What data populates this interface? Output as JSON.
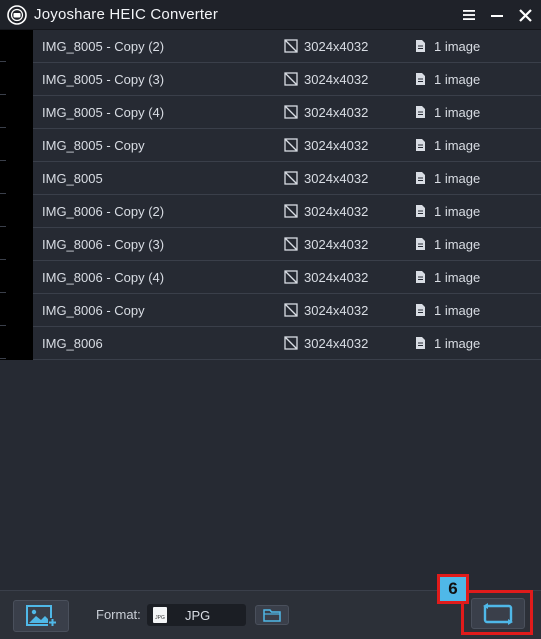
{
  "app": {
    "title": "Joyoshare HEIC Converter",
    "accent_color": "#4fb8e8",
    "highlight_color": "#e01b1b"
  },
  "window_controls": [
    {
      "name": "menu-icon"
    },
    {
      "name": "minimize-icon"
    },
    {
      "name": "close-icon"
    }
  ],
  "files": [
    {
      "name": "IMG_8005 - Copy (2)",
      "resolution": "3024x4032",
      "count": "1 image"
    },
    {
      "name": "IMG_8005 - Copy (3)",
      "resolution": "3024x4032",
      "count": "1 image"
    },
    {
      "name": "IMG_8005 - Copy (4)",
      "resolution": "3024x4032",
      "count": "1 image"
    },
    {
      "name": "IMG_8005 - Copy",
      "resolution": "3024x4032",
      "count": "1 image"
    },
    {
      "name": "IMG_8005",
      "resolution": "3024x4032",
      "count": "1 image"
    },
    {
      "name": "IMG_8006 - Copy (2)",
      "resolution": "3024x4032",
      "count": "1 image"
    },
    {
      "name": "IMG_8006 - Copy (3)",
      "resolution": "3024x4032",
      "count": "1 image"
    },
    {
      "name": "IMG_8006 - Copy (4)",
      "resolution": "3024x4032",
      "count": "1 image"
    },
    {
      "name": "IMG_8006 - Copy",
      "resolution": "3024x4032",
      "count": "1 image"
    },
    {
      "name": "IMG_8006",
      "resolution": "3024x4032",
      "count": "1 image"
    }
  ],
  "bottom": {
    "format_label": "Format:",
    "format_value": "JPG",
    "format_chip": "JPG",
    "step_badge": "6"
  }
}
